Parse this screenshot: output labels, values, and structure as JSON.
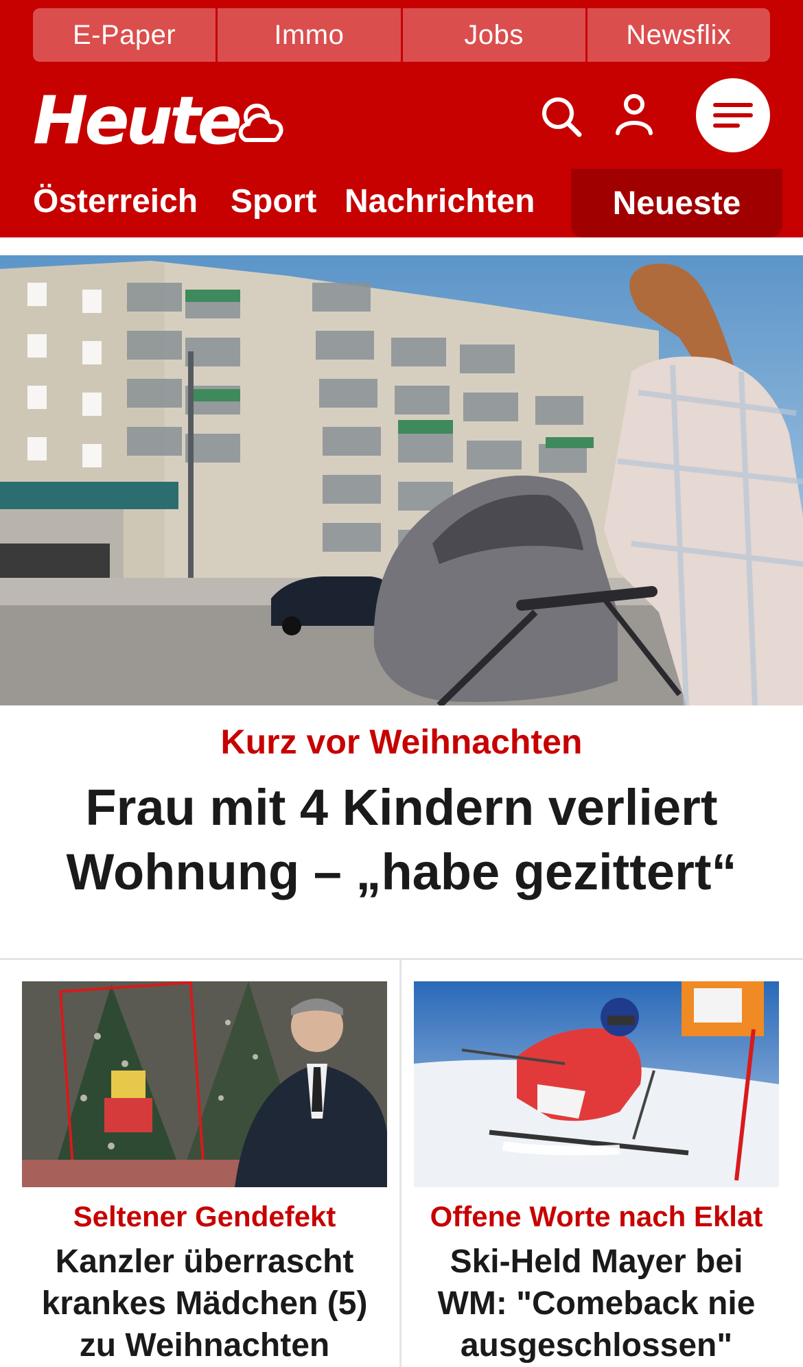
{
  "top_links": [
    {
      "label": "E-Paper"
    },
    {
      "label": "Immo"
    },
    {
      "label": "Jobs"
    },
    {
      "label": "Newsflix"
    }
  ],
  "brand": {
    "logo_text": "Heute",
    "weather_icon": "weather-cloud-sun-icon",
    "search_icon": "search-icon",
    "user_icon": "user-icon",
    "menu_icon": "hamburger-menu-icon"
  },
  "nav": {
    "items": [
      {
        "label": "Österreich"
      },
      {
        "label": "Sport"
      },
      {
        "label": "Nachrichten"
      }
    ],
    "active_label": "Neueste"
  },
  "hero": {
    "kicker": "Kurz vor Weihnachten",
    "title": "Frau mit 4 Kindern verliert Wohnung – „habe gezittert“"
  },
  "teasers": [
    {
      "kicker": "Seltener Gendefekt",
      "title": "Kanzler überrascht krankes Mädchen (5) zu Weihnachten"
    },
    {
      "kicker": "Offene Worte nach Eklat",
      "title": "Ski-Held Mayer bei WM: \"Comeback nie ausgeschlossen\""
    }
  ],
  "colors": {
    "brand_red": "#c70000",
    "nav_active": "#a10000",
    "top_link_bg": "#db4e4e",
    "text_dark": "#1a1a1a"
  }
}
